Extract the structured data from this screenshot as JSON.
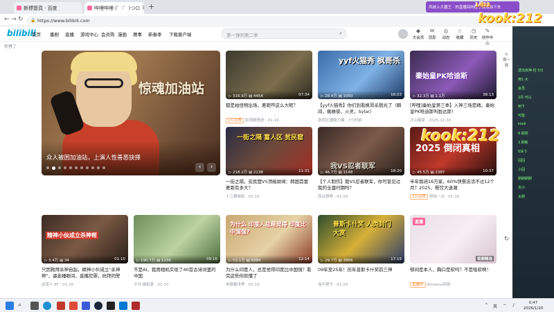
{
  "browser": {
    "tab1_title": "新標簽頁 · 百度",
    "tab2_title": "哔哩哔哩 (゜-゜)つロ 干杯~-bilibili",
    "url": "https://www.bilibili.com"
  },
  "header": {
    "logo": "bilibili",
    "nav": [
      "首页",
      "番剧",
      "直播",
      "游戏中心",
      "会员购",
      "漫画",
      "赛事",
      "新春季",
      "下载客户端"
    ],
    "search_placeholder": "第一弹列第二季",
    "user_icons": [
      "大会员",
      "消息",
      "动态",
      "收藏",
      "历史",
      "创作中心"
    ],
    "notice": "新春了"
  },
  "carousel": {
    "overlay_title": "惊魂加油站",
    "caption": "众人被困加油站，上演人性善恶抉择",
    "dot_count": 11,
    "active_dot": 1
  },
  "cards": [
    {
      "title": "都是拍怪物出场，差距咋这么大呢？",
      "views": "316.9万",
      "danmaku": "4454",
      "duration": "07:34",
      "tag": "1万点赞",
      "meta": "影视剧情迷 · 01-16",
      "overlay": ""
    },
    {
      "title": "【yyf火猫秀】你们到看枫哥杀戮光了（瞬间，蜘蛛侠，火灵，Sylar）",
      "views": "28.4万",
      "danmaku": "1050",
      "duration": "16:03",
      "tag": "",
      "meta": "游戏区播聊力摸 · 7小时前",
      "overlay": "yyf火猫秀 枫哥杀"
    },
    {
      "title": "[哔哩]秦始皇第三季】入神三场是精。秦始皇PK哈迪斯叫胜达斯！",
      "views": "32.3万",
      "danmaku": "1.1万",
      "duration": "38:13",
      "tag": "",
      "meta": "次山猫家 · 2025-12-30",
      "overlay": "秦始皇PK哈迪斯"
    },
    {
      "title": "一街之隔，贫民窟VS顶级财阀：韩国首富差距有多大？",
      "views": "218.2万",
      "danmaku": "2138",
      "duration": "11:31",
      "tag": "",
      "meta": "十三翼晓影 · 01-16",
      "overlay": "一街之隔 富人区 贫民窟"
    },
    {
      "title": "【个人制作】我VS忍者联军，你可曾见过我的全盛时期吗？",
      "views": "46.7万",
      "danmaku": "1148",
      "duration": "18:20",
      "tag": "",
      "meta": "西瓜想帮 · 01-16",
      "overlay": "我VS忍者联军"
    },
    {
      "title": "半年倒闭16万家，60%快餐店活不过12个月？2025，餐饮大退潮",
      "views": "45.5万",
      "danmaku": "2387",
      "duration": "10:37",
      "tag": "1万点赞",
      "meta": "财经一点 · 01-16",
      "overlay": "2025 倒闭真相"
    },
    {
      "title": "只因救拜杀神自起，精神小伙成立\"杀神帮\"，逼走睡眼间，直播犯罪，抗拜同警",
      "views": "3.4万",
      "danmaku": "34",
      "duration": "01:10",
      "tag": "",
      "meta": "这菜人 EF · 01-16",
      "overlay": "精神小伙成立杀神帮"
    },
    {
      "title": "不是AI，我用相机实现了40首古诗词里的中国",
      "views": "190.7万",
      "danmaku": "1236",
      "duration": "09:16",
      "tag": "",
      "meta": "夕月·摄影家 · 01-10",
      "overlay": ""
    },
    {
      "title": "为什么印度人，总是觉得印度比中国强？看完这些你就懂了",
      "views": "53.1万",
      "danmaku": "9384",
      "duration": "12:14",
      "tag": "",
      "meta": "老眼看世界 · 01-10",
      "overlay": "为什么 印度人总是觉得 印度比中国强?"
    },
    {
      "title": "09年至25年！历年普斯卡什奖前三神",
      "views": "29.7万",
      "danmaku": "3866",
      "duration": "17:19",
      "tag": "",
      "meta": "海牛帮子 · 01-29",
      "overlay": "普斯卡什奖 人类封门大赏"
    },
    {
      "title": "郁闷是本人，胸口是软吗？不是吸软啊！",
      "views": "",
      "danmaku": "",
      "duration": "",
      "tag": "直播中",
      "meta": "Amoena玥玥",
      "overlay": "直播",
      "badge": "视频精选"
    }
  ],
  "side": {
    "refresh": "换一换"
  },
  "overlay": {
    "brand": "kook:212",
    "brand2": "kook:212",
    "date_num": "1月23",
    "toolbar": "风歧上大魔王 · 的直播间响应了屁股拍下去",
    "chat_lines": [
      "送出双神·柱 5分",
      "用1 大",
      "会员",
      "2月 可以",
      "刺下",
      "可能",
      "kook",
      "8 刷票",
      "3 刷新",
      "6块 5",
      "回回",
      "小回",
      "刷刷刷刷",
      "天小",
      "太刷"
    ]
  },
  "taskbar": {
    "time": "0:47",
    "date": "2026/1/20",
    "lang": "中",
    "tray": "英"
  }
}
